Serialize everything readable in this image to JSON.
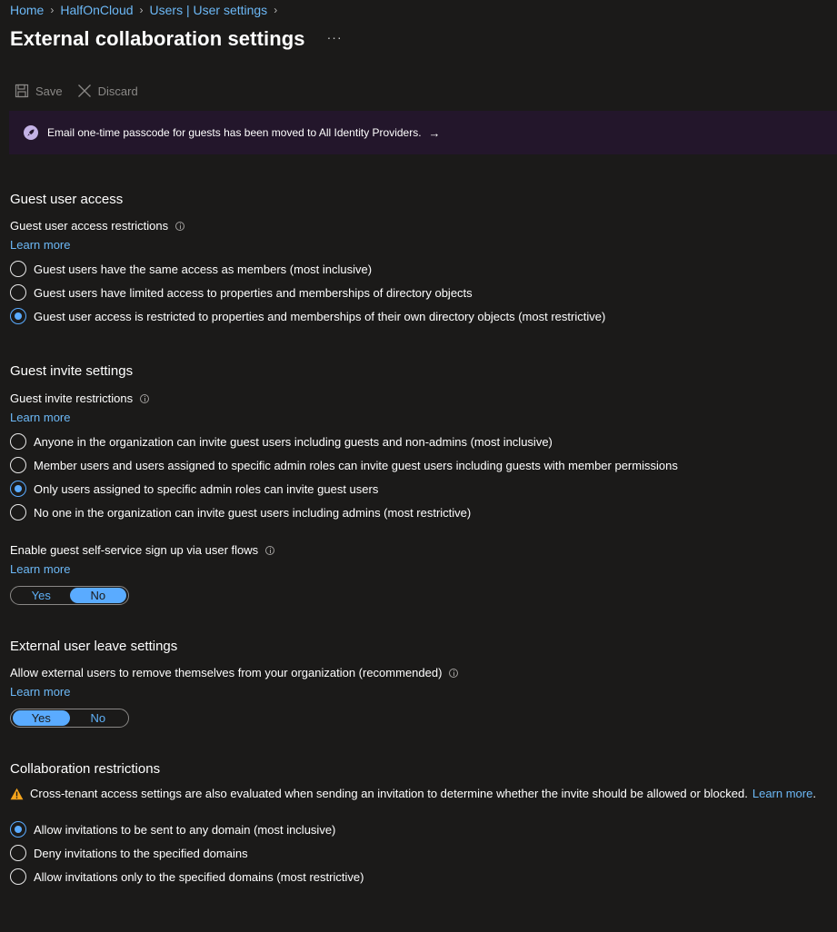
{
  "breadcrumb": [
    "Home",
    "HalfOnCloud",
    "Users | User settings"
  ],
  "title": "External collaboration settings",
  "more_label": "···",
  "toolbar": {
    "save": "Save",
    "discard": "Discard"
  },
  "banner": {
    "text": "Email one-time passcode for guests has been moved to All Identity Providers.",
    "arrow": "→"
  },
  "guest_access": {
    "heading": "Guest user access",
    "label": "Guest user access restrictions",
    "learn_more": "Learn more",
    "options": [
      "Guest users have the same access as members (most inclusive)",
      "Guest users have limited access to properties and memberships of directory objects",
      "Guest user access is restricted to properties and memberships of their own directory objects (most restrictive)"
    ],
    "selected_index": 2
  },
  "guest_invite": {
    "heading": "Guest invite settings",
    "label": "Guest invite restrictions",
    "learn_more": "Learn more",
    "options": [
      "Anyone in the organization can invite guest users including guests and non-admins (most inclusive)",
      "Member users and users assigned to specific admin roles can invite guest users including guests with member permissions",
      "Only users assigned to specific admin roles can invite guest users",
      "No one in the organization can invite guest users including admins (most restrictive)"
    ],
    "selected_index": 2,
    "self_service": {
      "label": "Enable guest self-service sign up via user flows",
      "learn_more": "Learn more",
      "yes": "Yes",
      "no": "No",
      "selected": "No"
    }
  },
  "leave": {
    "heading": "External user leave settings",
    "label": "Allow external users to remove themselves from your organization (recommended)",
    "learn_more": "Learn more",
    "yes": "Yes",
    "no": "No",
    "selected": "Yes"
  },
  "collab": {
    "heading": "Collaboration restrictions",
    "warning": "Cross-tenant access settings are also evaluated when sending an invitation to determine whether the invite should be allowed or blocked.",
    "warning_link": "Learn more",
    "warning_tail": ".",
    "options": [
      "Allow invitations to be sent to any domain (most inclusive)",
      "Deny invitations to the specified domains",
      "Allow invitations only to the specified domains (most restrictive)"
    ],
    "selected_index": 0
  },
  "colors": {
    "background": "#1b1a19",
    "link": "#6cb8f6",
    "accent": "#5aabff",
    "banner": "#23162b",
    "warning": "#f7a51c"
  }
}
